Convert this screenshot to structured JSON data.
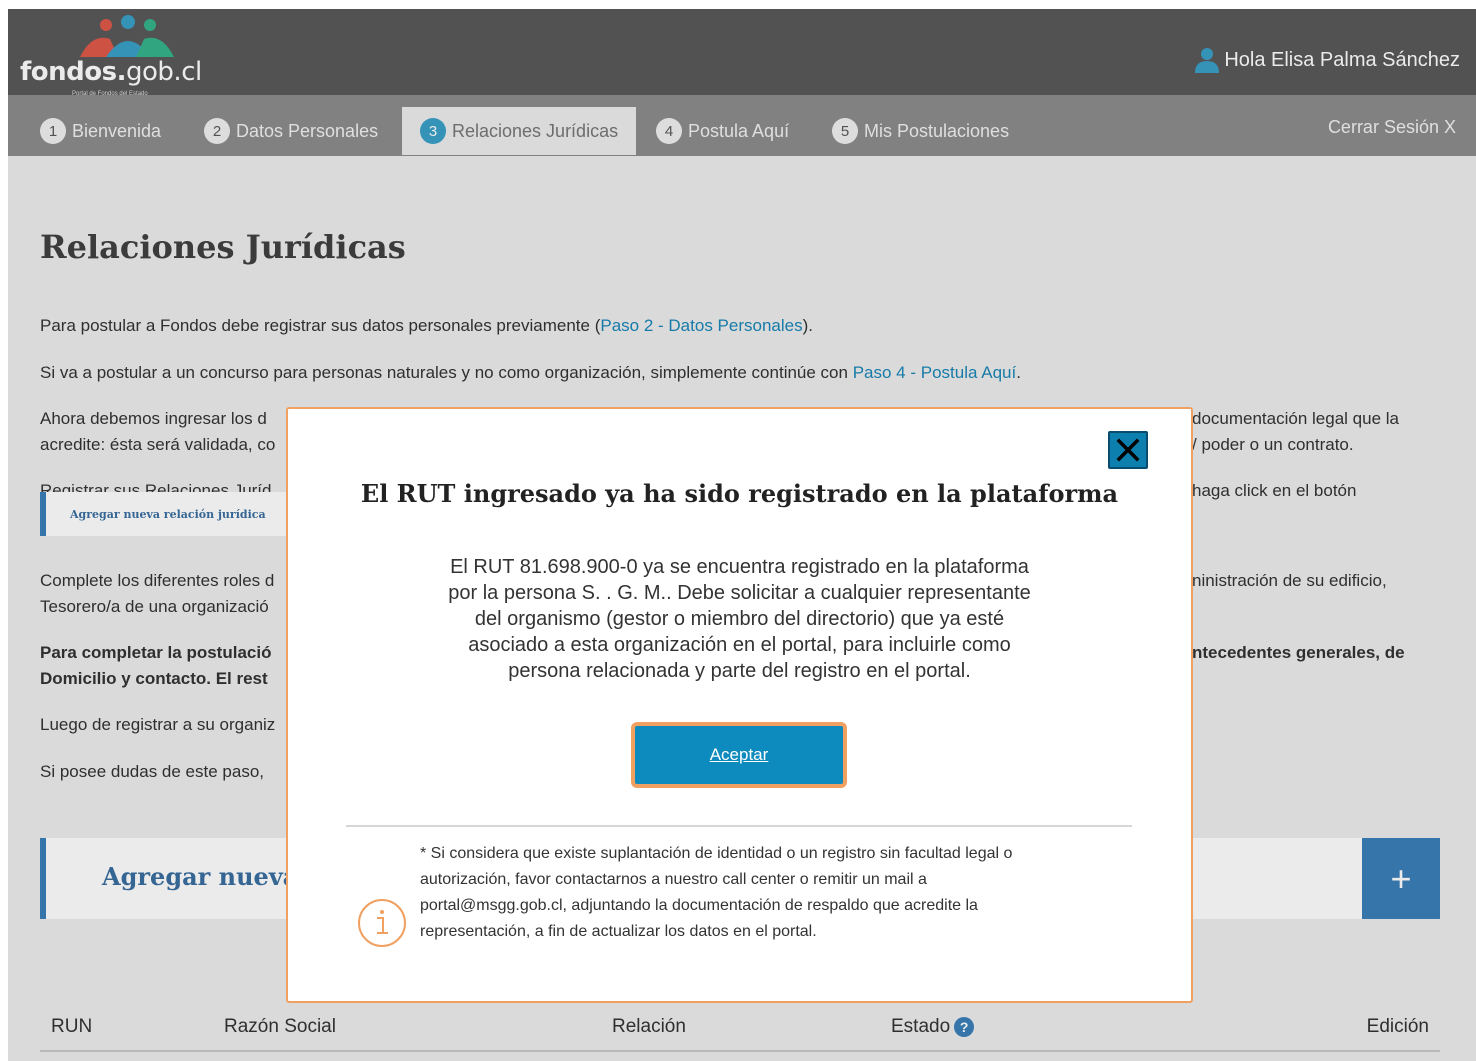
{
  "header": {
    "logo_bold": "fondos.",
    "logo_light": "gob.cl",
    "logo_sub": "Portal de Fondos del Estado",
    "greeting": "Hola Elisa Palma Sánchez",
    "user_icon": "user-icon"
  },
  "tabs": [
    {
      "num": "1",
      "label": "Bienvenida"
    },
    {
      "num": "2",
      "label": "Datos Personales"
    },
    {
      "num": "3",
      "label": "Relaciones Jurídicas"
    },
    {
      "num": "4",
      "label": "Postula Aquí"
    },
    {
      "num": "5",
      "label": "Mis Postulaciones"
    }
  ],
  "logout": "Cerrar Sesión X",
  "main": {
    "title": "Relaciones Jurídicas",
    "p1_pre": "Para postular a Fondos debe registrar sus datos personales previamente (",
    "p1_link": "Paso 2 - Datos Personales",
    "p1_post": ").",
    "p2_pre": "Si va a postular a un concurso para personas naturales y no como organización, simplemente continúe con ",
    "p2_link": "Paso 4 - Postula Aquí",
    "p2_post": ".",
    "p3_line1a": "Ahora debemos ingresar los d",
    "p3_line1b": "documentación legal que la",
    "p3_line2a": "acredite: ésta será validada, co",
    "p3_line2b": "/ poder o un contrato.",
    "p4a": "Registrar sus Relaciones Juríd",
    "p4b": "haga click en el botón",
    "small_button": "Agregar nueva relación jurídica",
    "p5_line1a": "Complete los diferentes roles d",
    "p5_line1b": "ninistración de su edificio,",
    "p5_line2a": "Tesorero/a de una organizació",
    "p6_line1a": "Para completar la postulació",
    "p6_line1b": "ntecedentes generales, de",
    "p6_line2a": "Domicilio y contacto. El rest",
    "p7a": "Luego de registrar a su organiz",
    "p8a": "Si posee dudas de este paso, ",
    "add_bar_label": "Agregar nueva re",
    "add_bar_plus": "+",
    "table_headers": {
      "run": "RUN",
      "razon_social": "Razón Social",
      "relacion": "Relación",
      "estado": "Estado",
      "edicion": "Edición"
    },
    "help_glyph": "?"
  },
  "modal": {
    "title": "El RUT ingresado ya ha sido registrado en la plataforma",
    "body_lines": [
      "El RUT 81.698.900-0 ya se encuentra registrado en la plataforma",
      "por la persona S. . G. M.. Debe solicitar a cualquier representante",
      "del organismo (gestor o miembro del directorio) que ya esté",
      "asociado a esta organización en el portal, para incluirle como",
      "persona relacionada y parte del registro en el portal."
    ],
    "accept_label": "Aceptar",
    "note_lines": [
      "* Si considera que existe suplantación de identidad o un registro sin facultad legal o",
      "autorización, favor contactarnos a nuestro call center o remitir un mail a",
      "portal@msgg.gob.cl, adjuntando la documentación de respaldo que acredite la",
      "representación, a fin de actualizar los datos en el portal."
    ],
    "close_icon": "close-icon",
    "info_icon": "info-icon"
  },
  "colors": {
    "header_bg": "#595959",
    "tabs_bg": "#8c8c8c",
    "accent_blue": "#0d8bbe",
    "modal_border": "#f0a060",
    "link": "#1a86b8"
  }
}
